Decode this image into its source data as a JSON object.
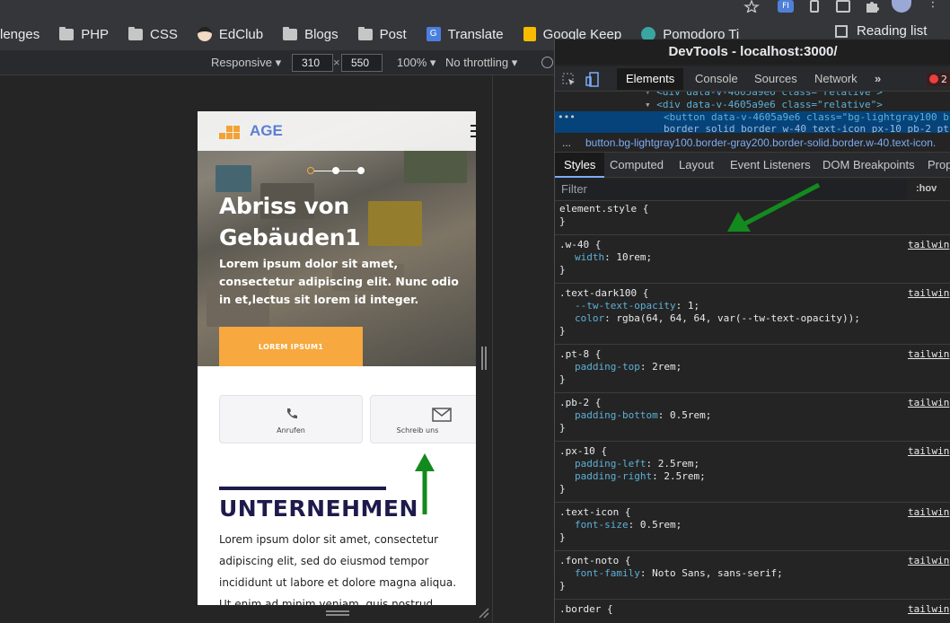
{
  "browser": {
    "bookmarks": [
      {
        "label": "lenges",
        "icon": "none"
      },
      {
        "label": "PHP",
        "icon": "folder-icon"
      },
      {
        "label": "CSS",
        "icon": "folder-icon"
      },
      {
        "label": "EdClub",
        "icon": "edclub-icon"
      },
      {
        "label": "Blogs",
        "icon": "folder-icon"
      },
      {
        "label": "Post",
        "icon": "folder-icon"
      },
      {
        "label": "Translate",
        "icon": "translate-icon"
      },
      {
        "label": "Google Keep",
        "icon": "keep-icon"
      },
      {
        "label": "Pomodoro Ti",
        "icon": "pomodoro-icon"
      }
    ],
    "reading_list": "Reading list"
  },
  "device_toolbar": {
    "mode": "Responsive",
    "width": "310",
    "height": "550",
    "zoom": "100%",
    "throttling": "No throttling"
  },
  "page": {
    "brand": "AGE",
    "hero_title": "Abriss von Gebäuden1",
    "hero_text": "Lorem ipsum dolor sit amet, consectetur adipiscing elit. Nunc odio in et,lectus sit lorem id integer.",
    "hero_button": "LOREM IPSUM1",
    "contact_call": "Anrufen",
    "contact_write": "Schreib uns",
    "section_title": "UNTERNEHMEN",
    "section_text": "Lorem ipsum dolor sit amet, consectetur adipiscing elit, sed do eiusmod tempor incididunt ut labore et dolore magna aliqua. Ut enim ad minim veniam, quis nostrud"
  },
  "devtools": {
    "title": "DevTools - localhost:3000/",
    "tabs": [
      "Elements",
      "Console",
      "Sources",
      "Network"
    ],
    "more": "»",
    "error_count": "2",
    "dom_line1": "<div data-v-4605a9e6 class=\"relative\">",
    "dom_line2": "<button data-v-4605a9e6 class=\"bg-lightgray100 b",
    "dom_line3": "border solid border w-40 text-icon px-10 pb-2 pt-",
    "breadcrumb": "button.bg-lightgray100.border-gray200.border-solid.border.w-40.text-icon.",
    "breadcrumb_dots": "...",
    "sub_tabs": [
      "Styles",
      "Computed",
      "Layout",
      "Event Listeners",
      "DOM Breakpoints",
      "Prop"
    ],
    "filter_placeholder": "Filter",
    "hov": ":hov",
    "rules": [
      {
        "selector": "element.style {",
        "source": "",
        "decls": []
      },
      {
        "selector": ".w-40 {",
        "source": "tailwin",
        "decls": [
          {
            "p": "width",
            "v": "10rem;"
          }
        ]
      },
      {
        "selector": ".text-dark100 {",
        "source": "tailwin",
        "decls": [
          {
            "p": "--tw-text-opacity",
            "v": "1;"
          },
          {
            "p": "color",
            "v": "rgba(64, 64, 64, var(--tw-text-opacity));"
          }
        ]
      },
      {
        "selector": ".pt-8 {",
        "source": "tailwin",
        "decls": [
          {
            "p": "padding-top",
            "v": "2rem;"
          }
        ]
      },
      {
        "selector": ".pb-2 {",
        "source": "tailwin",
        "decls": [
          {
            "p": "padding-bottom",
            "v": "0.5rem;"
          }
        ]
      },
      {
        "selector": ".px-10 {",
        "source": "tailwin",
        "decls": [
          {
            "p": "padding-left",
            "v": "2.5rem;"
          },
          {
            "p": "padding-right",
            "v": "2.5rem;"
          }
        ]
      },
      {
        "selector": ".text-icon {",
        "source": "tailwin",
        "decls": [
          {
            "p": "font-size",
            "v": "0.5rem;"
          }
        ]
      },
      {
        "selector": ".font-noto {",
        "source": "tailwin",
        "decls": [
          {
            "p": "font-family",
            "v": "Noto Sans, sans-serif;"
          }
        ]
      },
      {
        "selector": ".border {",
        "source": "tailwin",
        "decls": []
      }
    ]
  },
  "colors": {
    "accent_orange": "#f7a83e",
    "brand_blue": "#5b7fd3",
    "navy": "#1e1a4b",
    "annotation_green": "#138a1e"
  }
}
